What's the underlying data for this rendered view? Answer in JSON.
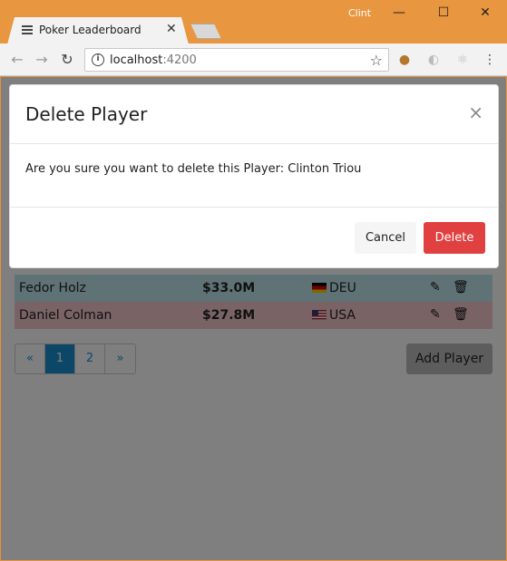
{
  "window": {
    "tab_title": "Poker Leaderboard",
    "user": "Clint"
  },
  "toolbar": {
    "url_host": "localhost",
    "url_port": ":4200"
  },
  "table": {
    "rows": [
      {
        "name": "Fedor Holz",
        "winnings": "$33.0M",
        "country": "DEU",
        "row_color": "#bee5eb"
      },
      {
        "name": "Daniel Colman",
        "winnings": "$27.8M",
        "country": "USA",
        "row_color": "#f5c6cb"
      }
    ]
  },
  "pagination": {
    "prev": "«",
    "pages": [
      "1",
      "2"
    ],
    "active_page": "1",
    "next": "»"
  },
  "add_player_label": "Add Player",
  "modal": {
    "title": "Delete Player",
    "close": "×",
    "message": "Are you sure you want to delete this Player: Clinton Triou",
    "cancel_label": "Cancel",
    "delete_label": "Delete"
  },
  "colors": {
    "accent": "#1a8fd1",
    "danger": "#e04040",
    "window_frame": "#e8963f"
  }
}
